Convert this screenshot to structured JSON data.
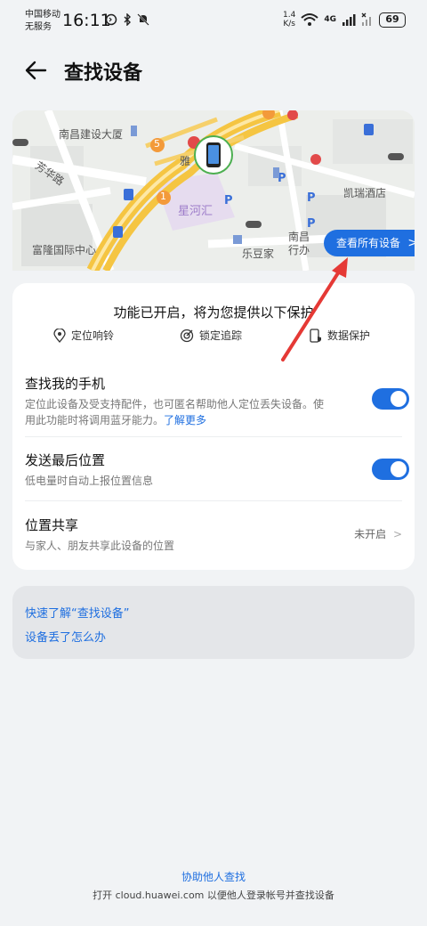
{
  "status_bar": {
    "carrier_line1": "中国移动",
    "carrier_line2": "无服务",
    "time": "16:11",
    "net_speed_value": "1.4",
    "net_speed_unit": "K/s",
    "network": "4G",
    "battery": "69"
  },
  "header": {
    "title": "查找设备"
  },
  "map": {
    "labels": [
      "南昌建设大厦",
      "芳华路",
      "雅",
      "星河汇",
      "凯瑞酒店",
      "富隆国际中心",
      "乐豆家",
      "南昌",
      "行办"
    ],
    "poi_numbers": [
      "5",
      "1"
    ],
    "view_all_button": "查看所有设备"
  },
  "protection": {
    "headline": "功能已开启，将为您提供以下保护",
    "features": [
      "定位响铃",
      "锁定追踪",
      "数据保护"
    ]
  },
  "settings": {
    "find_phone": {
      "title": "查找我的手机",
      "desc": "定位此设备及受支持配件，也可匿名帮助他人定位丢失设备。使用此功能时将调用蓝牙能力。",
      "link": "了解更多",
      "enabled": true
    },
    "last_location": {
      "title": "发送最后位置",
      "desc": "低电量时自动上报位置信息",
      "enabled": true
    },
    "location_share": {
      "title": "位置共享",
      "desc": "与家人、朋友共享此设备的位置",
      "status": "未开启"
    }
  },
  "help_links": [
    "快速了解“查找设备”",
    "设备丢了怎么办"
  ],
  "footer": {
    "link": "协助他人查找",
    "text": "打开 cloud.huawei.com 以便他人登录帐号并查找设备"
  },
  "colors": {
    "accent": "#1f6fe0",
    "annotation_arrow": "#e53935"
  }
}
